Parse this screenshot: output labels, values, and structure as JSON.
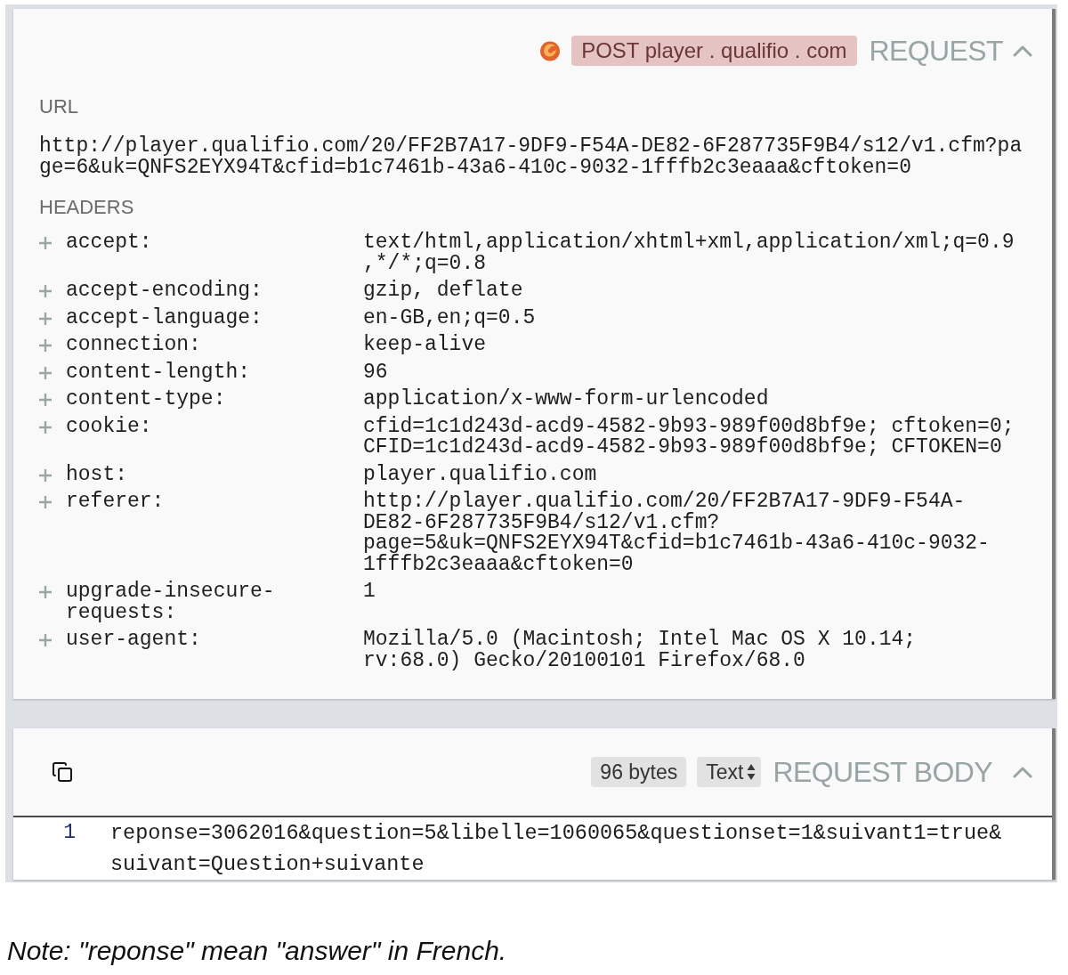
{
  "request_panel": {
    "method_host_badge": "POST player . qualifio . com",
    "title": "REQUEST",
    "expanded": true,
    "url_label": "URL",
    "url": "http://player.qualifio.com/20/FF2B7A17-9DF9-F54A-DE82-6F287735F9B4/s12/v1.cfm?page=6&uk=QNFS2EYX94T&cfid=b1c7461b-43a6-410c-9032-1fffb2c3eaaa&cftoken=0",
    "headers_label": "HEADERS",
    "headers": [
      {
        "name": "accept:",
        "value": "text/html,application/xhtml+xml,application/xml;q=0.9,*/*;q=0.8"
      },
      {
        "name": "accept-encoding:",
        "value": "gzip, deflate"
      },
      {
        "name": "accept-language:",
        "value": "en-GB,en;q=0.5"
      },
      {
        "name": "connection:",
        "value": "keep-alive"
      },
      {
        "name": "content-length:",
        "value": "96"
      },
      {
        "name": "content-type:",
        "value": "application/x-www-form-urlencoded"
      },
      {
        "name": "cookie:",
        "value": "cfid=1c1d243d-acd9-4582-9b93-989f00d8bf9e; cftoken=0; CFID=1c1d243d-acd9-4582-9b93-989f00d8bf9e; CFTOKEN=0"
      },
      {
        "name": "host:",
        "value": "player.qualifio.com"
      },
      {
        "name": "referer:",
        "value": "http://player.qualifio.com/20/FF2B7A17-9DF9-F54A-DE82-6F287735F9B4/s12/v1.cfm?page=5&uk=QNFS2EYX94T&cfid=b1c7461b-43a6-410c-9032-1fffb2c3eaaa&cftoken=0"
      },
      {
        "name": "upgrade-insecure-requests:",
        "value": "1"
      },
      {
        "name": "user-agent:",
        "value": "Mozilla/5.0 (Macintosh; Intel Mac OS X 10.14; rv:68.0) Gecko/20100101 Firefox/68.0"
      }
    ]
  },
  "request_body_panel": {
    "size_badge": "96 bytes",
    "format_select": "Text",
    "title": "REQUEST BODY",
    "expanded": true,
    "lines": [
      {
        "number": "1",
        "text": "reponse=3062016&question=5&libelle=1060065&questionset=1&suivant1=true&suivant=Question+suivante"
      }
    ]
  },
  "note": "Note: \"reponse\" mean \"answer\" in French."
}
